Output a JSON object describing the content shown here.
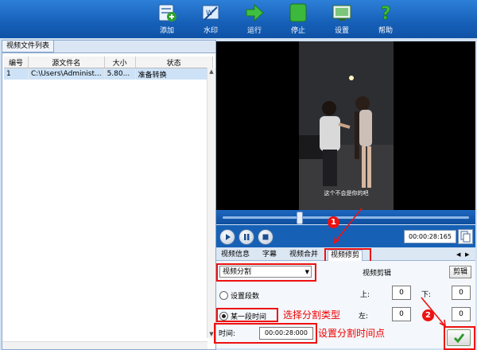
{
  "toolbar": {
    "buttons": [
      {
        "label": "添加",
        "icon": "add-file-icon"
      },
      {
        "label": "水印",
        "icon": "watermark-icon"
      },
      {
        "label": "运行",
        "icon": "run-arrow-icon"
      },
      {
        "label": "停止",
        "icon": "stop-icon"
      },
      {
        "label": "设置",
        "icon": "settings-icon"
      },
      {
        "label": "帮助",
        "icon": "help-icon"
      }
    ]
  },
  "file_list": {
    "tab_label": "视频文件列表",
    "columns": [
      "编号",
      "源文件名",
      "大小",
      "状态"
    ],
    "rows": [
      {
        "id": "1",
        "name": "C:\\Users\\Administ...",
        "size": "5.80...",
        "status": "准备转换"
      }
    ]
  },
  "player": {
    "subtitle": "这个不会是你的吧",
    "time": "00:00:28:165",
    "progress_fraction": 0.31
  },
  "edit_tabs": [
    "视频信息",
    "字幕",
    "视频合并",
    "视频修剪"
  ],
  "edit_tabs_nav": {
    "left": "◀",
    "right": "▶"
  },
  "edit_panel": {
    "split_mode": "视频分割",
    "radio_count_label": "设置段数",
    "radio_time_label": "某一段时间",
    "time_label": "时间:",
    "time_value": "00:00:28:000",
    "crop_title": "视频剪辑",
    "crop_button": "剪辑",
    "top_label": "上:",
    "top_value": "0",
    "bottom_label": "下:",
    "bottom_value": "0",
    "left_label": "左:",
    "left_value": "0",
    "right_value": "0"
  },
  "annotations": {
    "marker_1": "1",
    "marker_2": "2",
    "choose_type": "选择分割类型",
    "set_point": "设置分割时间点"
  },
  "colors": {
    "accent": "#1660b8",
    "annotation": "#ee1111"
  }
}
